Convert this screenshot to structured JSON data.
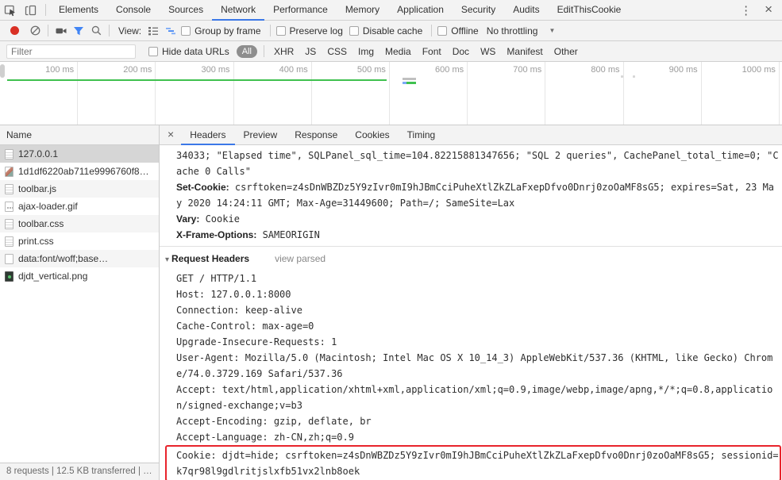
{
  "colors": {
    "accent_blue": "#3b78e7",
    "record_red": "#d93025",
    "funnel_blue": "#4285f4",
    "overview_green": "#3fc14f",
    "pill_gray": "#8e8e8e",
    "highlight_red": "#e8242c"
  },
  "glyphs": {
    "kebab": "⋮",
    "close": "×",
    "detail_close": "×",
    "caret_down": "▼",
    "disclosure_open": "▾"
  },
  "devtools_tabs": {
    "items": [
      "Elements",
      "Console",
      "Sources",
      "Network",
      "Performance",
      "Memory",
      "Application",
      "Security",
      "Audits",
      "EditThisCookie"
    ],
    "active": "Network"
  },
  "toolbar": {
    "view_label": "View:",
    "group_by_frame_label": "Group by frame",
    "preserve_log_label": "Preserve log",
    "disable_cache_label": "Disable cache",
    "offline_label": "Offline",
    "throttling_label": "No throttling"
  },
  "filter_bar": {
    "placeholder": "Filter",
    "hide_data_urls_label": "Hide data URLs",
    "types": [
      "All",
      "XHR",
      "JS",
      "CSS",
      "Img",
      "Media",
      "Font",
      "Doc",
      "WS",
      "Manifest",
      "Other"
    ],
    "selected_type": "All"
  },
  "overview": {
    "ticks": [
      "100 ms",
      "200 ms",
      "300 ms",
      "400 ms",
      "500 ms",
      "600 ms",
      "700 ms",
      "800 ms",
      "900 ms",
      "1000 ms"
    ]
  },
  "requests": {
    "header": "Name",
    "rows": [
      {
        "label": "127.0.0.1",
        "icon": "document",
        "selected": true
      },
      {
        "label": "1d1df6220ab711e9996760f8…",
        "icon": "image",
        "selected": false
      },
      {
        "label": "toolbar.js",
        "icon": "document",
        "selected": false
      },
      {
        "label": "ajax-loader.gif",
        "icon": "image-dots",
        "selected": false
      },
      {
        "label": "toolbar.css",
        "icon": "document",
        "selected": false
      },
      {
        "label": "print.css",
        "icon": "document",
        "selected": false
      },
      {
        "label": "data:font/woff;base…",
        "icon": "plain",
        "selected": false
      },
      {
        "label": "djdt_vertical.png",
        "icon": "image-dark",
        "selected": false
      }
    ]
  },
  "details": {
    "tabs": [
      "Headers",
      "Preview",
      "Response",
      "Cookies",
      "Timing"
    ],
    "active": "Headers"
  },
  "headers_panel": {
    "lines": [
      {
        "kind": "mono",
        "text": "34033; \"Elapsed time\", SQLPanel_sql_time=104.82215881347656; \"SQL 2 queries\", CachePanel_total_time=0; \"C"
      },
      {
        "kind": "mono",
        "text": "ache 0 Calls\""
      },
      {
        "kind": "pair",
        "name": "Set-Cookie:",
        "value": " csrftoken=z4sDnWBZDz5Y9zIvr0mI9hJBmCciPuheXtlZkZLaFxepDfvo0Dnrj0zoOaMF8sG5; expires=Sat, 23 Ma"
      },
      {
        "kind": "mono",
        "text": "y 2020 14:24:11 GMT; Max-Age=31449600; Path=/; SameSite=Lax"
      },
      {
        "kind": "pair",
        "name": "Vary:",
        "value": " Cookie"
      },
      {
        "kind": "pair",
        "name": "X-Frame-Options:",
        "value": " SAMEORIGIN"
      },
      {
        "kind": "section",
        "title": "Request Headers",
        "link": "view parsed"
      },
      {
        "kind": "mono",
        "text": "GET / HTTP/1.1"
      },
      {
        "kind": "mono",
        "text": "Host: 127.0.0.1:8000"
      },
      {
        "kind": "mono",
        "text": "Connection: keep-alive"
      },
      {
        "kind": "mono",
        "text": "Cache-Control: max-age=0"
      },
      {
        "kind": "mono",
        "text": "Upgrade-Insecure-Requests: 1"
      },
      {
        "kind": "mono",
        "text": "User-Agent: Mozilla/5.0 (Macintosh; Intel Mac OS X 10_14_3) AppleWebKit/537.36 (KHTML, like Gecko) Chrom"
      },
      {
        "kind": "mono",
        "text": "e/74.0.3729.169 Safari/537.36"
      },
      {
        "kind": "mono",
        "text": "Accept: text/html,application/xhtml+xml,application/xml;q=0.9,image/webp,image/apng,*/*;q=0.8,applicatio"
      },
      {
        "kind": "mono",
        "text": "n/signed-exchange;v=b3"
      },
      {
        "kind": "mono",
        "text": "Accept-Encoding: gzip, deflate, br"
      },
      {
        "kind": "mono",
        "text": "Accept-Language: zh-CN,zh;q=0.9"
      },
      {
        "kind": "box",
        "lines": [
          "Cookie: djdt=hide; csrftoken=z4sDnWBZDz5Y9zIvr0mI9hJBmCciPuheXtlZkZLaFxepDfvo0Dnrj0zoOaMF8sG5; sessionid=",
          "k7qr98l9gdlritjslxfb51vx2lnb8oek"
        ]
      }
    ]
  },
  "status_bar": {
    "summary": "8 requests | 12.5 KB transferred | …"
  }
}
